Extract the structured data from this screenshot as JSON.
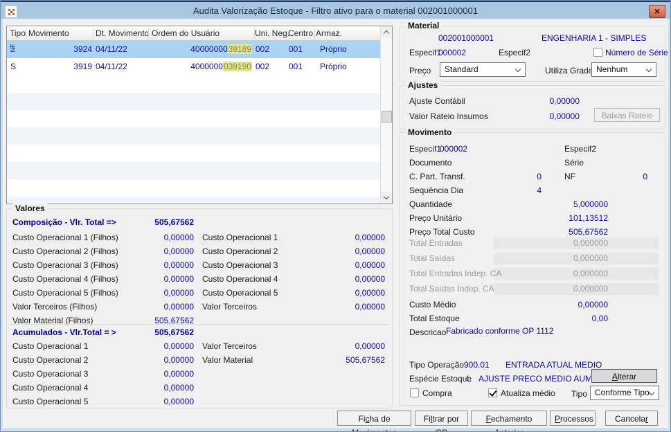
{
  "colors": {
    "accent_navy": "#0000a0",
    "titlebar_blue": "#a9c6e2",
    "selected_row": "#abd4f4",
    "highlight_yellow": "#e4e48a",
    "close_red": "#cd5f44",
    "panel_gray": "#f0f0f0"
  },
  "window": {
    "title": "Audita Valorização Estoque - Filtro ativo para o material 002001000001",
    "close_glyph": "×"
  },
  "table": {
    "columns": [
      "Tipo",
      "Movimento",
      "Dt. Movimento",
      "Ordem do Usuário",
      "Uni. Neg.",
      "Centro",
      "Armaz."
    ],
    "rows": [
      {
        "tipo": "NF",
        "movimento": "3924",
        "data": "04/11/22",
        "ordem_prefix": "40000000",
        "ordem_highlight": "39189",
        "uni_neg": "002",
        "centro": "001",
        "armaz": "Próprio"
      },
      {
        "tipo": "S",
        "movimento": "3919",
        "data": "04/11/22",
        "ordem_prefix": "4000000",
        "ordem_highlight": "039190",
        "uni_neg": "002",
        "centro": "001",
        "armaz": "Próprio"
      }
    ]
  },
  "material": {
    "title": "Material",
    "codigo": "002001000001",
    "descricao": "ENGENHARIA 1 - SIMPLES",
    "especif1_label": "Especif1",
    "especif1_value": "000002",
    "especif2_label": "Especif2",
    "numero_serie_label": "Número de Série",
    "preco_label": "Preço",
    "preco_value": "Standard",
    "utiliza_grade_label": "Utiliza Grade",
    "utiliza_grade_value": "Nenhum"
  },
  "ajustes": {
    "title": "Ajustes",
    "ajuste_contabil_label": "Ajuste Contábil",
    "ajuste_contabil_value": "0,00000",
    "valor_rateio_label": "Valor Rateio Insumos",
    "valor_rateio_value": "0,00000",
    "baixas_rateio_label": "Baixas Rateio"
  },
  "movimento": {
    "title": "Movimento",
    "especif1_label": "Especif1",
    "especif1_value": "000002",
    "especif2_label": "Especif2",
    "documento_label": "Documento",
    "serie_label": "Série",
    "cpart_label": "C. Part. Transf.",
    "cpart_value": "0",
    "nf_label": "NF",
    "nf_value": "0",
    "seq_label": "Sequência Dia",
    "seq_value": "4",
    "qtd_label": "Quantidade",
    "qtd_value": "5,000000",
    "preco_unit_label": "Preço Unitário",
    "preco_unit_value": "101,13512",
    "preco_total_label": "Preço Total Custo",
    "preco_total_value": "505,67562",
    "disabled_rows": [
      {
        "label": "Total Entradas",
        "value": "0,000000"
      },
      {
        "label": "Total Saídas",
        "value": "0,000000"
      },
      {
        "label": "Total Entradas Indep. CA",
        "value": "0,000000"
      },
      {
        "label": "Total Saídas Indep. CA",
        "value": "0,000000"
      }
    ],
    "custo_medio_label": "Custo Médio",
    "custo_medio_value": "0,00000",
    "total_estoque_label": "Total Estoque",
    "total_estoque_value": "0,00",
    "descricao_label": "Descricao",
    "descricao_value": "Fabricado conforme OP 1112",
    "tipo_op_label": "Tipo Operação",
    "tipo_op_code": "900.01",
    "tipo_op_desc": "ENTRADA ATUAL MEDIO",
    "especie_label": "Espécie Estoque",
    "especie_code": "L",
    "especie_desc": "AJUSTE PRECO MEDIO AUMENTA",
    "alterar_especie": {
      "pre": "",
      "key": "A",
      "post": "lterar Espécie"
    },
    "compra_label": "Compra",
    "atualiza_label": "Atualiza médio",
    "tipo_label": "Tipo",
    "tipo_value": "Conforme Tipo"
  },
  "valores": {
    "title": "Valores",
    "composicao": {
      "heading": "Composição - Vlr. Total =>",
      "total": "505,67562",
      "left": [
        {
          "label": "Custo Operacional 1 (Filhos)",
          "value": "0,00000"
        },
        {
          "label": "Custo Operacional 2 (Filhos)",
          "value": "0,00000"
        },
        {
          "label": "Custo Operacional 3 (Filhos)",
          "value": "0,00000"
        },
        {
          "label": "Custo Operacional 4 (Filhos)",
          "value": "0,00000"
        },
        {
          "label": "Custo Operacional 5 (Filhos)",
          "value": "0,00000"
        },
        {
          "label": "Valor Terceiros (Filhos)",
          "value": "0,00000"
        },
        {
          "label": "Valor Material (Filhos)",
          "value": "505,67562"
        }
      ],
      "right": [
        {
          "label": "Custo Operacional 1",
          "value": "0,00000"
        },
        {
          "label": "Custo Operacional 2",
          "value": "0,00000"
        },
        {
          "label": "Custo Operacional 3",
          "value": "0,00000"
        },
        {
          "label": "Custo Operacional 4",
          "value": "0,00000"
        },
        {
          "label": "Custo Operacional 5",
          "value": "0,00000"
        },
        {
          "label": "Valor Terceiros",
          "value": "0,00000"
        }
      ]
    },
    "acumulados": {
      "heading": "Acumulados - Vlr.Total = >",
      "total": "505,67562",
      "left": [
        {
          "label": "Custo Operacional 1",
          "value": "0,00000"
        },
        {
          "label": "Custo Operacional 2",
          "value": "0,00000"
        },
        {
          "label": "Custo Operacional 3",
          "value": "0,00000"
        },
        {
          "label": "Custo Operacional 4",
          "value": "0,00000"
        },
        {
          "label": "Custo Operacional 5",
          "value": "0,00000"
        }
      ],
      "right": [
        {
          "label": "Valor Terceiros",
          "value": "0,00000"
        },
        {
          "label": "Valor Material",
          "value": "505,67562"
        }
      ]
    }
  },
  "footer": {
    "buttons": [
      {
        "pre": "Fi",
        "key": "c",
        "post": "ha de Movimentos"
      },
      {
        "pre": "Fi",
        "key": "l",
        "post": "trar por OP"
      },
      {
        "pre": "",
        "key": "F",
        "post": "echamento Anterior"
      },
      {
        "pre": "",
        "key": "P",
        "post": "rocessos"
      },
      {
        "pre": "Cancela",
        "key": "r",
        "post": ""
      }
    ]
  }
}
